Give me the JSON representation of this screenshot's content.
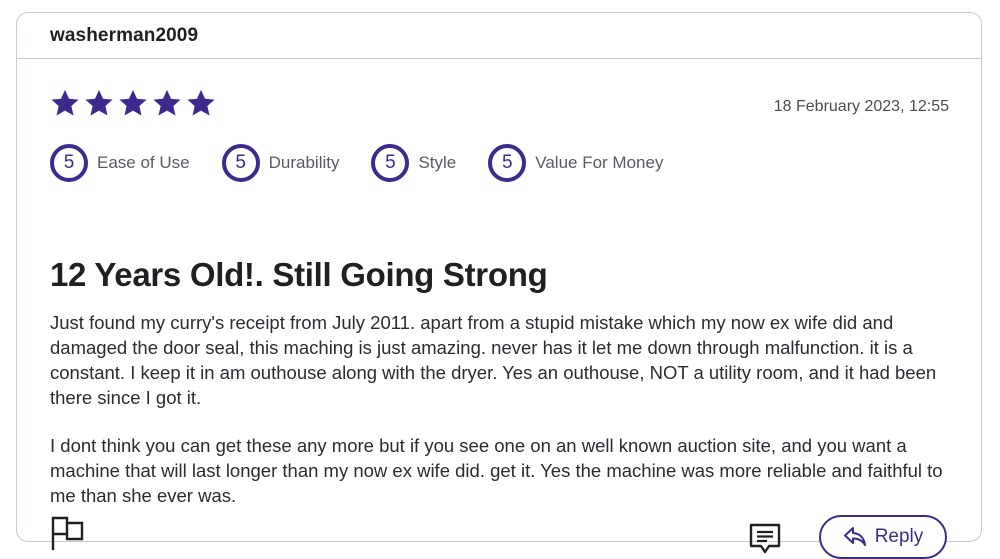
{
  "review": {
    "username": "washerman2009",
    "star_rating": 5,
    "star_max": 5,
    "date": "18 February 2023, 12:55",
    "ratings": [
      {
        "score": "5",
        "label": "Ease of Use"
      },
      {
        "score": "5",
        "label": "Durability"
      },
      {
        "score": "5",
        "label": "Style"
      },
      {
        "score": "5",
        "label": "Value For Money"
      }
    ],
    "title": "12 Years Old!. Still Going Strong",
    "paragraphs": [
      "Just found my curry's receipt from July 2011. apart from a stupid mistake which my now ex wife did and damaged the door seal, this maching is just amazing. never has it let me down through malfunction. it is a constant. I keep it in am outhouse along with the dryer. Yes an outhouse, NOT a utility room, and it had been there since I got it.",
      "I dont think you can get these any more but if you see one on an well known auction site, and you want a machine that will last longer than my now ex wife did. get it. Yes the machine was more reliable and faithful to me than she ever was."
    ]
  },
  "actions": {
    "flag_icon": "flag-icon",
    "comment_icon": "comment-icon",
    "reply_label": "Reply",
    "reply_icon": "reply-arrow-icon"
  },
  "colors": {
    "accent": "#3d2a8c",
    "border": "#c9c9d6"
  }
}
